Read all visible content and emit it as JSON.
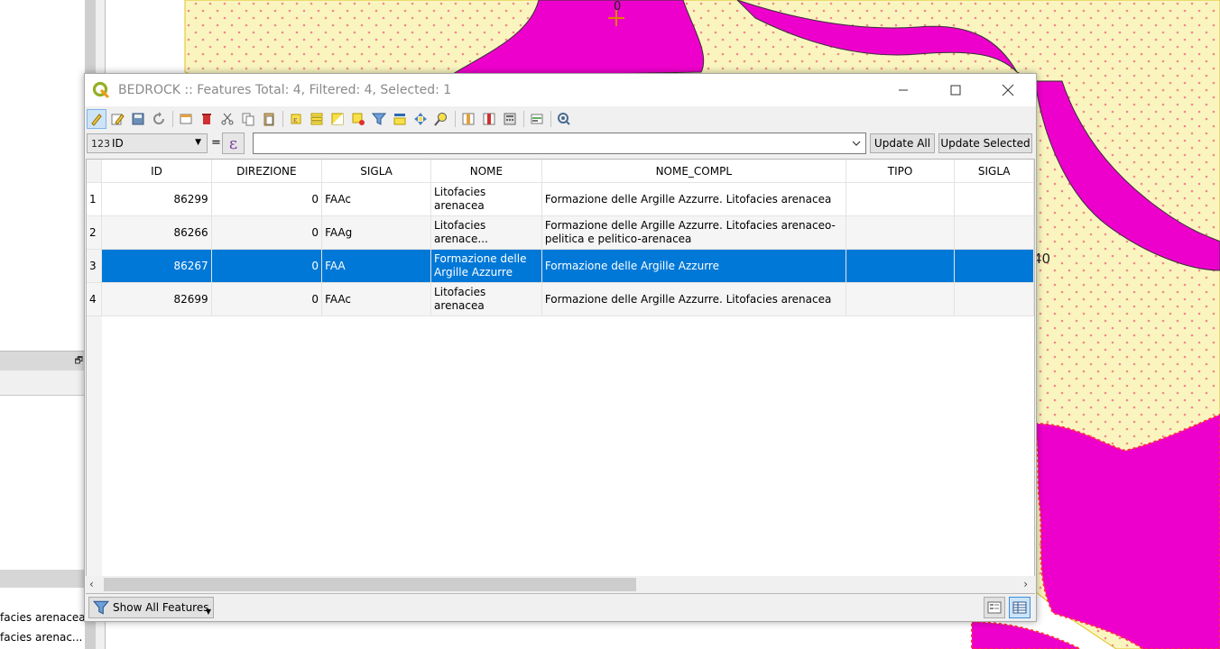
{
  "background": {
    "left_panel_labels": [
      "facies arenacea",
      "facies arenac..."
    ],
    "map_labels": [
      "0",
      "40"
    ],
    "colors": {
      "unit_magenta": "#ee00cc",
      "dotted_fill": "#faf5bf",
      "dot_color": "#f08a8a"
    }
  },
  "window": {
    "title": "BEDROCK :: Features Total: 4, Filtered: 4, Selected: 1",
    "icon": "qgis-logo-icon",
    "controls": [
      "minimize-icon",
      "maximize-icon",
      "close-icon"
    ]
  },
  "toolbar": {
    "icons": [
      "toggle-editing-icon",
      "multi-edit-icon",
      "save-edits-icon",
      "reload-icon",
      "add-feature-icon",
      "delete-feature-icon",
      "cut-icon",
      "copy-icon",
      "paste-icon",
      "expression-select-icon",
      "select-all-icon",
      "invert-selection-icon",
      "deselect-icon",
      "filter-icon",
      "move-selection-top-icon",
      "pan-to-selection-icon",
      "zoom-to-selection-icon",
      "new-field-icon",
      "delete-field-icon",
      "field-calculator-icon",
      "conditional-formatting-icon",
      "actions-icon"
    ]
  },
  "field_bar": {
    "field_type": "123",
    "field_name": "ID",
    "equals": "=",
    "expression_symbol": "ε",
    "expression_value": "",
    "update_all_label": "Update All",
    "update_selected_label": "Update Selected"
  },
  "table": {
    "columns": [
      "ID",
      "DIREZIONE",
      "SIGLA",
      "NOME",
      "NOME_COMPL",
      "TIPO",
      "SIGLA"
    ],
    "rows": [
      {
        "n": "1",
        "id": "86299",
        "direzione": "0",
        "sigla": "FAAc",
        "nome": "Litofacies arenacea",
        "nome_compl": "Formazione delle Argille Azzurre. Litofacies arenacea",
        "tipo": "",
        "sigla2": ""
      },
      {
        "n": "2",
        "id": "86266",
        "direzione": "0",
        "sigla": "FAAg",
        "nome": "Litofacies arenace...",
        "nome_compl": "Formazione delle Argille Azzurre. Litofacies arenaceo-pelitica e pelitico-arenacea",
        "tipo": "",
        "sigla2": ""
      },
      {
        "n": "3",
        "id": "86267",
        "direzione": "0",
        "sigla": "FAA",
        "nome": "Formazione delle Argille Azzurre",
        "nome_compl": "Formazione delle Argille Azzurre",
        "tipo": "",
        "sigla2": ""
      },
      {
        "n": "4",
        "id": "82699",
        "direzione": "0",
        "sigla": "FAAc",
        "nome": "Litofacies arenacea",
        "nome_compl": "Formazione delle Argille Azzurre. Litofacies arenacea",
        "tipo": "",
        "sigla2": ""
      }
    ],
    "selected_row": "3",
    "selection_color": "#0078d7"
  },
  "bottom": {
    "show_all_label": "Show All Features",
    "view_buttons": [
      "form-view-icon",
      "table-view-icon"
    ]
  }
}
